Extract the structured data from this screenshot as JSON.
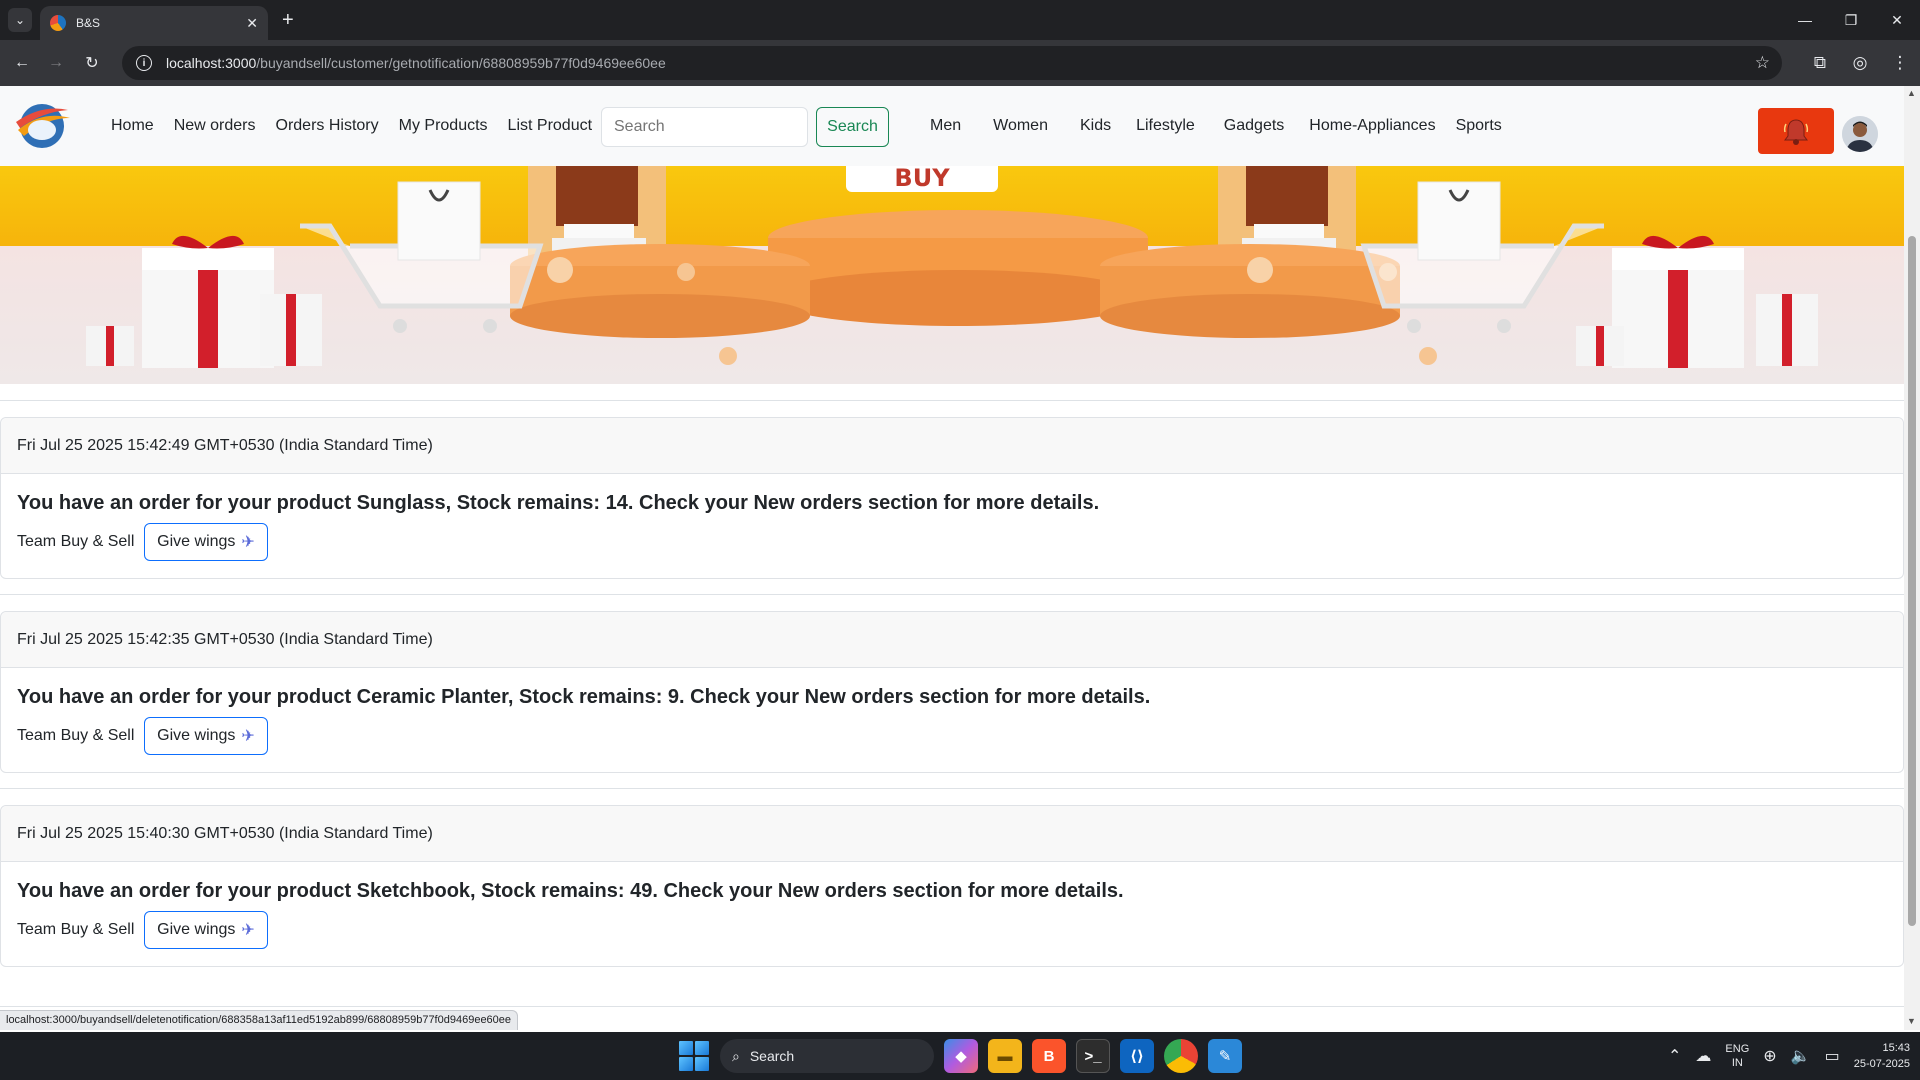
{
  "browser": {
    "tab_title": "B&S",
    "url_host": "localhost:3000",
    "url_path": "/buyandsell/customer/getnotification/68808959b77f0d9469ee60ee",
    "status_url": "localhost:3000/buyandsell/deletenotification/688358a13af11ed5192ab899/68808959b77f0d9469ee60ee"
  },
  "navbar": {
    "links": [
      "Home",
      "New orders",
      "Orders History",
      "My Products",
      "List Product"
    ],
    "search_placeholder": "Search",
    "search_button": "Search",
    "categories": [
      "Men",
      "Women",
      "Kids",
      "Lifestyle",
      "Gadgets",
      "Home-Appliances",
      "Sports"
    ]
  },
  "banner": {
    "sign_text": "BUY"
  },
  "notifications": [
    {
      "timestamp": "Fri Jul 25 2025 15:42:49 GMT+0530 (India Standard Time)",
      "message": "You have an order for your product Sunglass, Stock remains: 14. Check your New orders section for more details.",
      "signature": "Team Buy & Sell",
      "button": "Give wings"
    },
    {
      "timestamp": "Fri Jul 25 2025 15:42:35 GMT+0530 (India Standard Time)",
      "message": "You have an order for your product Ceramic Planter, Stock remains: 9. Check your New orders section for more details.",
      "signature": "Team Buy & Sell",
      "button": "Give wings"
    },
    {
      "timestamp": "Fri Jul 25 2025 15:40:30 GMT+0530 (India Standard Time)",
      "message": "You have an order for your product Sketchbook, Stock remains: 49. Check your New orders section for more details.",
      "signature": "Team Buy & Sell",
      "button": "Give wings"
    }
  ],
  "taskbar": {
    "search_label": "Search",
    "lang_line1": "ENG",
    "lang_line2": "IN",
    "time": "15:43",
    "date": "25-07-2025"
  },
  "colors": {
    "bell_button": "#e8380f",
    "search_button": "#198754",
    "give_wings_border": "#0d6efd"
  }
}
